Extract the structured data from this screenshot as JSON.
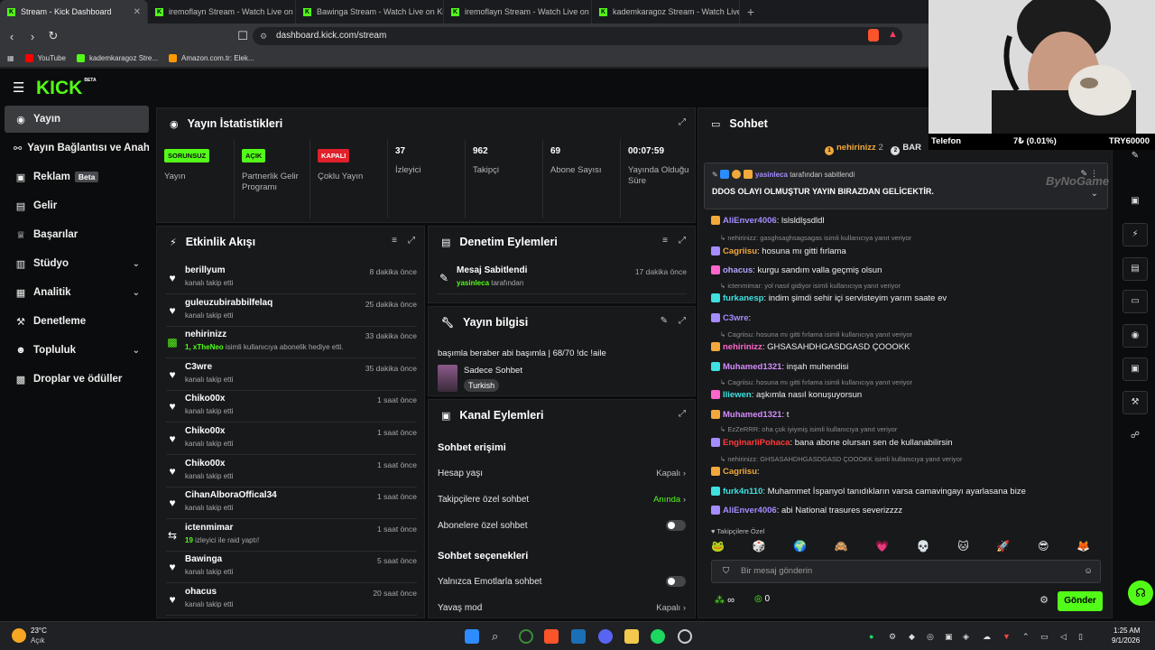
{
  "browser": {
    "tabs": [
      {
        "label": "Stream - Kick Dashboard",
        "active": true
      },
      {
        "label": "iremoflayn Stream - Watch Live on K"
      },
      {
        "label": "Bawinga Stream - Watch Live on Kick"
      },
      {
        "label": "iremoflayn Stream - Watch Live on K"
      },
      {
        "label": "kademkaragoz Stream - Watch Live o"
      }
    ],
    "url": "dashboard.kick.com/stream",
    "bookmarks": [
      "YouTube",
      "kademkaragoz Stre...",
      "Amazon.com.tr: Elek..."
    ]
  },
  "brand": {
    "logo": "KICK",
    "beta": "BETA",
    "accent": "#53fc18"
  },
  "sidebar": {
    "items": [
      {
        "label": "Yayın",
        "icon": "broadcast-icon"
      },
      {
        "label": "Yayın Bağlantısı ve Anahtarı",
        "icon": "link-icon"
      },
      {
        "label": "Reklam",
        "icon": "ad-icon",
        "badge": "Beta"
      },
      {
        "label": "Gelir",
        "icon": "revenue-icon"
      },
      {
        "label": "Başarılar",
        "icon": "trophy-icon"
      },
      {
        "label": "Stüdyo",
        "icon": "studio-icon"
      },
      {
        "label": "Analitik",
        "icon": "analytics-icon"
      },
      {
        "label": "Denetleme",
        "icon": "hammer-icon"
      },
      {
        "label": "Topluluk",
        "icon": "community-icon"
      },
      {
        "label": "Droplar ve ödüller",
        "icon": "gift-icon"
      }
    ]
  },
  "stats": {
    "title": "Yayın İstatistikleri",
    "cells": [
      {
        "badge": "SORUNSUZ",
        "badge_color": "#53fc18",
        "label": "Yayın"
      },
      {
        "badge": "AÇIK",
        "badge_color": "#53fc18",
        "label": "Partnerlik Gelir Programı"
      },
      {
        "badge": "KAPALI",
        "badge_color": "#e0202a",
        "label": "Çoklu Yayın"
      },
      {
        "value": "37",
        "label": "İzleyici"
      },
      {
        "value": "962",
        "label": "Takipçi"
      },
      {
        "value": "69",
        "label": "Abone Sayısı"
      },
      {
        "value": "00:07:59",
        "label": "Yayında Olduğu Süre"
      }
    ]
  },
  "activity": {
    "title": "Etkinlik Akışı",
    "items": [
      {
        "name": "berillyum",
        "sub": "kanalı takip etti",
        "time": "8 dakika önce",
        "icon": "heart-icon"
      },
      {
        "name": "guleuzubirabbilfelaq",
        "sub": "kanalı takip etti",
        "time": "25 dakika önce",
        "icon": "heart-icon"
      },
      {
        "name": "nehirinizz",
        "sub_hl": "1, xTheNeo",
        "sub": " isimli kullanıcıya abonelik hediye etti.",
        "time": "33 dakika önce",
        "icon": "gift-icon"
      },
      {
        "name": "C3wre",
        "sub": "kanalı takip etti",
        "time": "35 dakika önce",
        "icon": "heart-icon"
      },
      {
        "name": "Chiko00x",
        "sub": "kanalı takip etti",
        "time": "1 saat önce",
        "icon": "heart-icon"
      },
      {
        "name": "Chiko00x",
        "sub": "kanalı takip etti",
        "time": "1 saat önce",
        "icon": "heart-icon"
      },
      {
        "name": "Chiko00x",
        "sub": "kanalı takip etti",
        "time": "1 saat önce",
        "icon": "heart-icon"
      },
      {
        "name": "CihanAlboraOffical34",
        "sub": "kanalı takip etti",
        "time": "1 saat önce",
        "icon": "heart-icon"
      },
      {
        "name": "ictenmimar",
        "sub_hl": "19",
        "sub": " izleyici ile raid yaptı!",
        "time": "1 saat önce",
        "icon": "raid-icon"
      },
      {
        "name": "Bawinga",
        "sub": "kanalı takip etti",
        "time": "5 saat önce",
        "icon": "heart-icon"
      },
      {
        "name": "ohacus",
        "sub": "kanalı takip etti",
        "time": "20 saat önce",
        "icon": "heart-icon"
      }
    ]
  },
  "moderation": {
    "title": "Denetim Eylemleri",
    "items": [
      {
        "name": "Mesaj Sabitlendi",
        "sub_hl": "yasinleca",
        "sub": " tarafından",
        "time": "17 dakika önce"
      }
    ]
  },
  "stream_info": {
    "title": "Yayın bilgisi",
    "stream_title": "başımla beraber abi başımla | 68/70 !dc !aile",
    "category": "Sadece Sohbet",
    "tag": "Turkish"
  },
  "channel_actions": {
    "title": "Kanal Eylemleri",
    "chat_access_title": "Sohbet erişimi",
    "account_age": {
      "label": "Hesap yaşı",
      "value": "Kapalı"
    },
    "followers_only": {
      "label": "Takipçilere özel sohbet",
      "value": "Anında"
    },
    "subs_only": {
      "label": "Abonelere özel sohbet"
    },
    "chat_options_title": "Sohbet seçenekleri",
    "emote_only": {
      "label": "Yalnızca Emotlarla sohbet"
    },
    "slow_mode": {
      "label": "Yavaş mod",
      "value": "Kapalı"
    }
  },
  "chat": {
    "title": "Sohbet",
    "top_gifter": "nehirinizz",
    "top_gifter_count": "2",
    "second": "BAR",
    "pinned_by": "yasinleca",
    "pinned_suffix": "tarafından sabitlendi",
    "pinned_text": "DDOS OLAYI OLMUŞTUR YAYIN BIRAZDAN GELİCEKTİR.",
    "watermark": "ByNoGame",
    "messages": [
      {
        "type": "msg",
        "user": "AliEnver4006",
        "color": "#a58cff",
        "text": "lslsldlşsdldl"
      },
      {
        "type": "reply",
        "text": "nehirinizz: gasghsaghsagsagas isimli kullanıcıya yanıt veriyor"
      },
      {
        "type": "msg",
        "user": "Cagriisu",
        "color": "#f2a93b",
        "text": "hosuna mı gitti fırlama"
      },
      {
        "type": "msg",
        "user": "ohacus",
        "color": "#b3a4ff",
        "text": "kurgu sandım valla geçmiş olsun"
      },
      {
        "type": "reply",
        "text": "ictenmimar: yol nasıl gidiyor isimli kullanıcıya yanıt veriyor"
      },
      {
        "type": "msg",
        "user": "furkanesp",
        "color": "#3ee0e0",
        "text": "indim şimdi sehir içi servisteyim yarım saate ev"
      },
      {
        "type": "msg",
        "user": "C3wre",
        "color": "#a58cff",
        "text": ""
      },
      {
        "type": "reply",
        "text": "Cagriisu: hosuna mı gitti fırlama isimli kullanıcıya yanıt veriyor"
      },
      {
        "type": "msg",
        "user": "nehirinizz",
        "color": "#ff66cc",
        "text": "GHSASAHDHGASDGASD ÇOOOKK"
      },
      {
        "type": "msg",
        "user": "Muhamed1321",
        "color": "#d48cff",
        "text": "inşah muhendisi"
      },
      {
        "type": "reply",
        "text": "Cagriisu: hosuna mı gitti fırlama isimli kullanıcıya yanıt veriyor"
      },
      {
        "type": "msg",
        "user": "lliewen",
        "color": "#3ee0e0",
        "text": "aşkımla nasıl konuşuyorsun"
      },
      {
        "type": "msg",
        "user": "Muhamed1321",
        "color": "#d48cff",
        "text": "t"
      },
      {
        "type": "reply",
        "text": "EzZeRRR: oha çok iyiymiş isimli kullanıcıya yanıt veriyor"
      },
      {
        "type": "msg",
        "user": "EnginarliPohaca",
        "color": "#ff3b3b",
        "text": "bana abone olursan sen de kullanabilirsin"
      },
      {
        "type": "reply",
        "text": "nehirinizz: GHSASAHDHGASDGASD ÇOOOKK isimli kullanıcıya yanıt veriyor"
      },
      {
        "type": "msg",
        "user": "Cagriisu",
        "color": "#f2a93b",
        "text": ""
      },
      {
        "type": "msg",
        "user": "furk4n110",
        "color": "#3ee0e0",
        "text": "Muhammet İspanyol tanıdıkların varsa camavingayı ayarlasana bize"
      },
      {
        "type": "msg",
        "user": "AliEnver4006",
        "color": "#a58cff",
        "text": "abi National trasures severizzzz"
      }
    ],
    "followers_only_label": "Takipçilere Özel",
    "placeholder": "Bir mesaj gönderin",
    "infinity": "∞",
    "points": "0",
    "send": "Gönder"
  },
  "webcam": {
    "telefon": "Telefon",
    "percent": "7₺ (0.01%)",
    "goal": "TRY60000"
  },
  "taskbar": {
    "temp": "23°C",
    "weather": "Açık",
    "time": "1:25 AM",
    "date": "9/1/2026"
  }
}
